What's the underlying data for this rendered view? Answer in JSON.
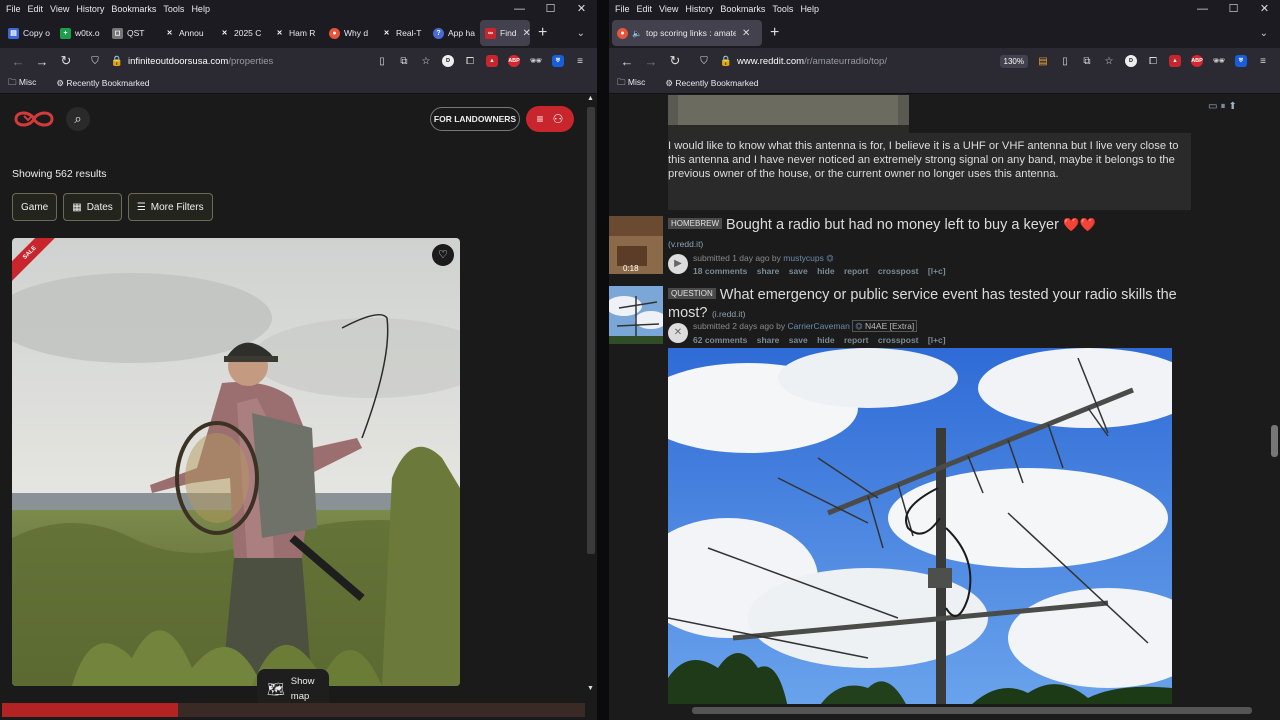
{
  "left": {
    "menu": [
      "File",
      "Edit",
      "View",
      "History",
      "Bookmarks",
      "Tools",
      "Help"
    ],
    "tabs": [
      {
        "label": "Copy o",
        "color": "#3b6ad8",
        "glyph": "▤"
      },
      {
        "label": "w0tx.o",
        "color": "#1e9e4a",
        "glyph": "+"
      },
      {
        "label": "QST",
        "color": "#9a9a9a",
        "glyph": "◻"
      },
      {
        "label": "Annou",
        "color": "#555",
        "glyph": "✕"
      },
      {
        "label": "2025 C",
        "color": "#555",
        "glyph": "✕"
      },
      {
        "label": "Ham R",
        "color": "#555",
        "glyph": "✕"
      },
      {
        "label": "Why d",
        "color": "#e8543b",
        "glyph": "●"
      },
      {
        "label": "Real-T",
        "color": "#555",
        "glyph": "✕"
      },
      {
        "label": "App ha",
        "color": "#4a6ad8",
        "glyph": "?"
      },
      {
        "label": "Find",
        "color": "#c8262c",
        "glyph": "∞"
      }
    ],
    "url_host": "infiniteoutdoorsusa.com",
    "url_path": "/properties",
    "bookmarks": [
      "Misc",
      "Recently Bookmarked"
    ],
    "site": {
      "landowners_label": "FOR LANDOWNERS",
      "results_text": "Showing 562 results",
      "filters": [
        "Game",
        "Dates",
        "More Filters"
      ],
      "sale_label": "SALE",
      "show_map_line1": "Show",
      "show_map_line2": "map"
    }
  },
  "right": {
    "menu": [
      "File",
      "Edit",
      "View",
      "History",
      "Bookmarks",
      "Tools",
      "Help"
    ],
    "tab_label": "top scoring links : amateur",
    "url_host": "www.reddit.com",
    "url_path": "/r/amateurradio/top/",
    "zoom": "130%",
    "bookmarks": [
      "Misc",
      "Recently Bookmarked"
    ],
    "post_text": "I would like to know what this antenna is for, I believe it is a UHF or VHF antenna but I live very close to this antenna and I have never noticed an extremely strong signal on any band, maybe it belongs to the previous owner of the house, or the current owner no longer uses this antenna.",
    "posts": [
      {
        "flair": "HOMEBREW",
        "title": "Bought a radio but had no money left to buy a keyer",
        "emoji": "❤️❤️",
        "domain": "(v.redd.it)",
        "submitted": "submitted 1 day ago by",
        "user": "mustycups",
        "user_flair": "",
        "duration": "0:18",
        "comments": "18 comments",
        "actions": [
          "share",
          "save",
          "hide",
          "report",
          "crosspost",
          "[l+c]"
        ]
      },
      {
        "flair": "QUESTION",
        "title": "What emergency or public service event has tested your radio skills the most?",
        "emoji": "",
        "domain": "(i.redd.it)",
        "submitted": "submitted 2 days ago by",
        "user": "CarrierCaveman",
        "user_flair": "N4AE [Extra]",
        "duration": "",
        "comments": "62 comments",
        "actions": [
          "share",
          "save",
          "hide",
          "report",
          "crosspost",
          "[l+c]"
        ]
      }
    ]
  }
}
